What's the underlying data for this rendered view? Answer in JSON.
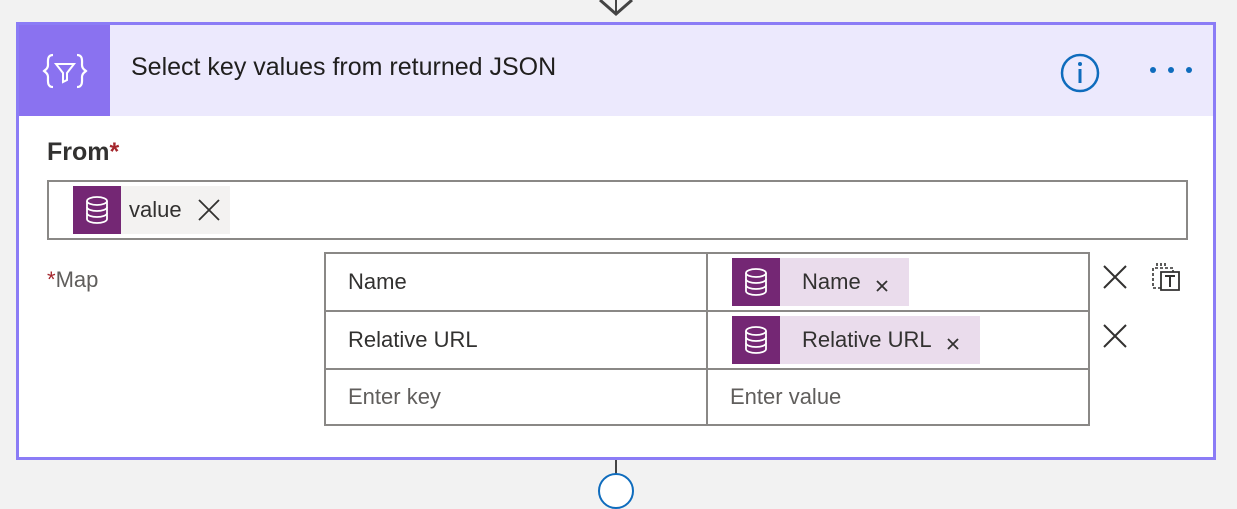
{
  "card": {
    "title": "Select key values from returned JSON",
    "accent_color": "#8a72f0",
    "header_bg": "#ece9fd",
    "icons": [
      "curly-braces-filter-icon",
      "info-icon",
      "more-options-icon"
    ]
  },
  "from": {
    "label": "From",
    "required_mark": "*",
    "token": {
      "label": "value",
      "icon": "database-icon",
      "color": "#742774"
    }
  },
  "map": {
    "label": "Map",
    "required_mark": "*",
    "rows": [
      {
        "key": "Name",
        "value_token": "Name"
      },
      {
        "key": "Relative URL",
        "value_token": "Relative URL"
      }
    ],
    "key_placeholder": "Enter key",
    "value_placeholder": "Enter value"
  }
}
